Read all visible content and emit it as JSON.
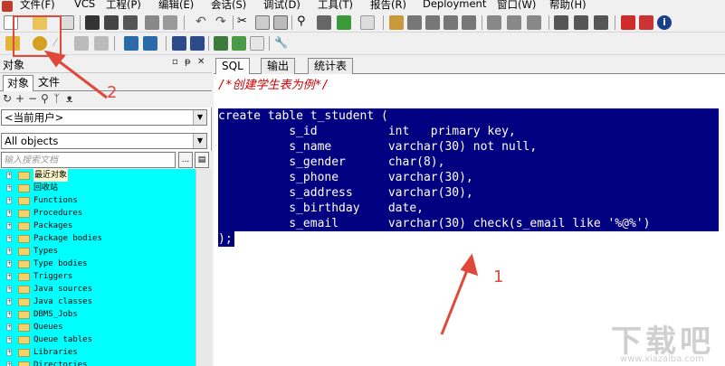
{
  "menubar": {
    "items": [
      "文件(F)",
      "VCS",
      "工程(P)",
      "编辑(E)",
      "会话(S)",
      "调试(D)",
      "工具(T)",
      "报告(R)",
      "Deployment",
      "窗口(W)",
      "帮助(H)"
    ]
  },
  "object_panel": {
    "title": "对象",
    "tabs": [
      "对象",
      "文件"
    ],
    "user_combo": "<当前用户>",
    "objects_combo": "All objects",
    "search_placeholder": "输入搜索文档",
    "search_btn1": "...",
    "search_btn2": "▤",
    "tree_items": [
      "最近对象",
      "回收站",
      "Functions",
      "Procedures",
      "Packages",
      "Package bodies",
      "Types",
      "Type bodies",
      "Triggers",
      "Java sources",
      "Java classes",
      "DBMS_Jobs",
      "Queues",
      "Queue tables",
      "Libraries",
      "Directories"
    ]
  },
  "editor": {
    "tabs": [
      "SQL",
      "输出",
      "统计表"
    ],
    "comment": "/*创建学生表为例*/",
    "lines": [
      "create table t_student (",
      "          s_id          int   primary key,",
      "          s_name        varchar(30) not null,",
      "          s_gender      char(8),",
      "          s_phone       varchar(30),",
      "          s_address     varchar(30),",
      "          s_birthday    date,",
      "          s_email       varchar(30) check(s_email like '%@%')",
      ");"
    ]
  },
  "annotations": {
    "label1": "1",
    "label2": "2",
    "color": "#e0483a"
  },
  "watermark": {
    "text": "下载吧",
    "url": "www.xiazaiba.com"
  },
  "colors": {
    "selection": "#000080",
    "tree_bg": "#00ffff",
    "comment": "#cc0000"
  }
}
